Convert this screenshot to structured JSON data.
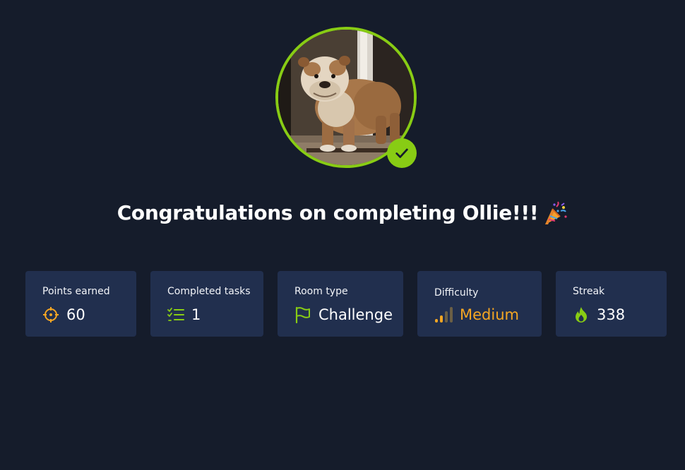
{
  "title": "Congratulations on completing Ollie!!!",
  "title_emoji": "party-popper",
  "avatar": {
    "subject": "bulldog photo",
    "status": "completed"
  },
  "colors": {
    "background": "#151c2b",
    "card": "#212f4e",
    "accent_green": "#88cc14",
    "orange": "#f5a623",
    "text": "#ffffff"
  },
  "stats": [
    {
      "label": "Points earned",
      "value": "60",
      "icon": "crosshair-icon"
    },
    {
      "label": "Completed tasks",
      "value": "1",
      "icon": "checklist-icon"
    },
    {
      "label": "Room type",
      "value": "Challenge",
      "icon": "flag-icon"
    },
    {
      "label": "Difficulty",
      "value": "Medium",
      "icon": "signal-bars-icon"
    },
    {
      "label": "Streak",
      "value": "338",
      "icon": "flame-icon"
    }
  ]
}
